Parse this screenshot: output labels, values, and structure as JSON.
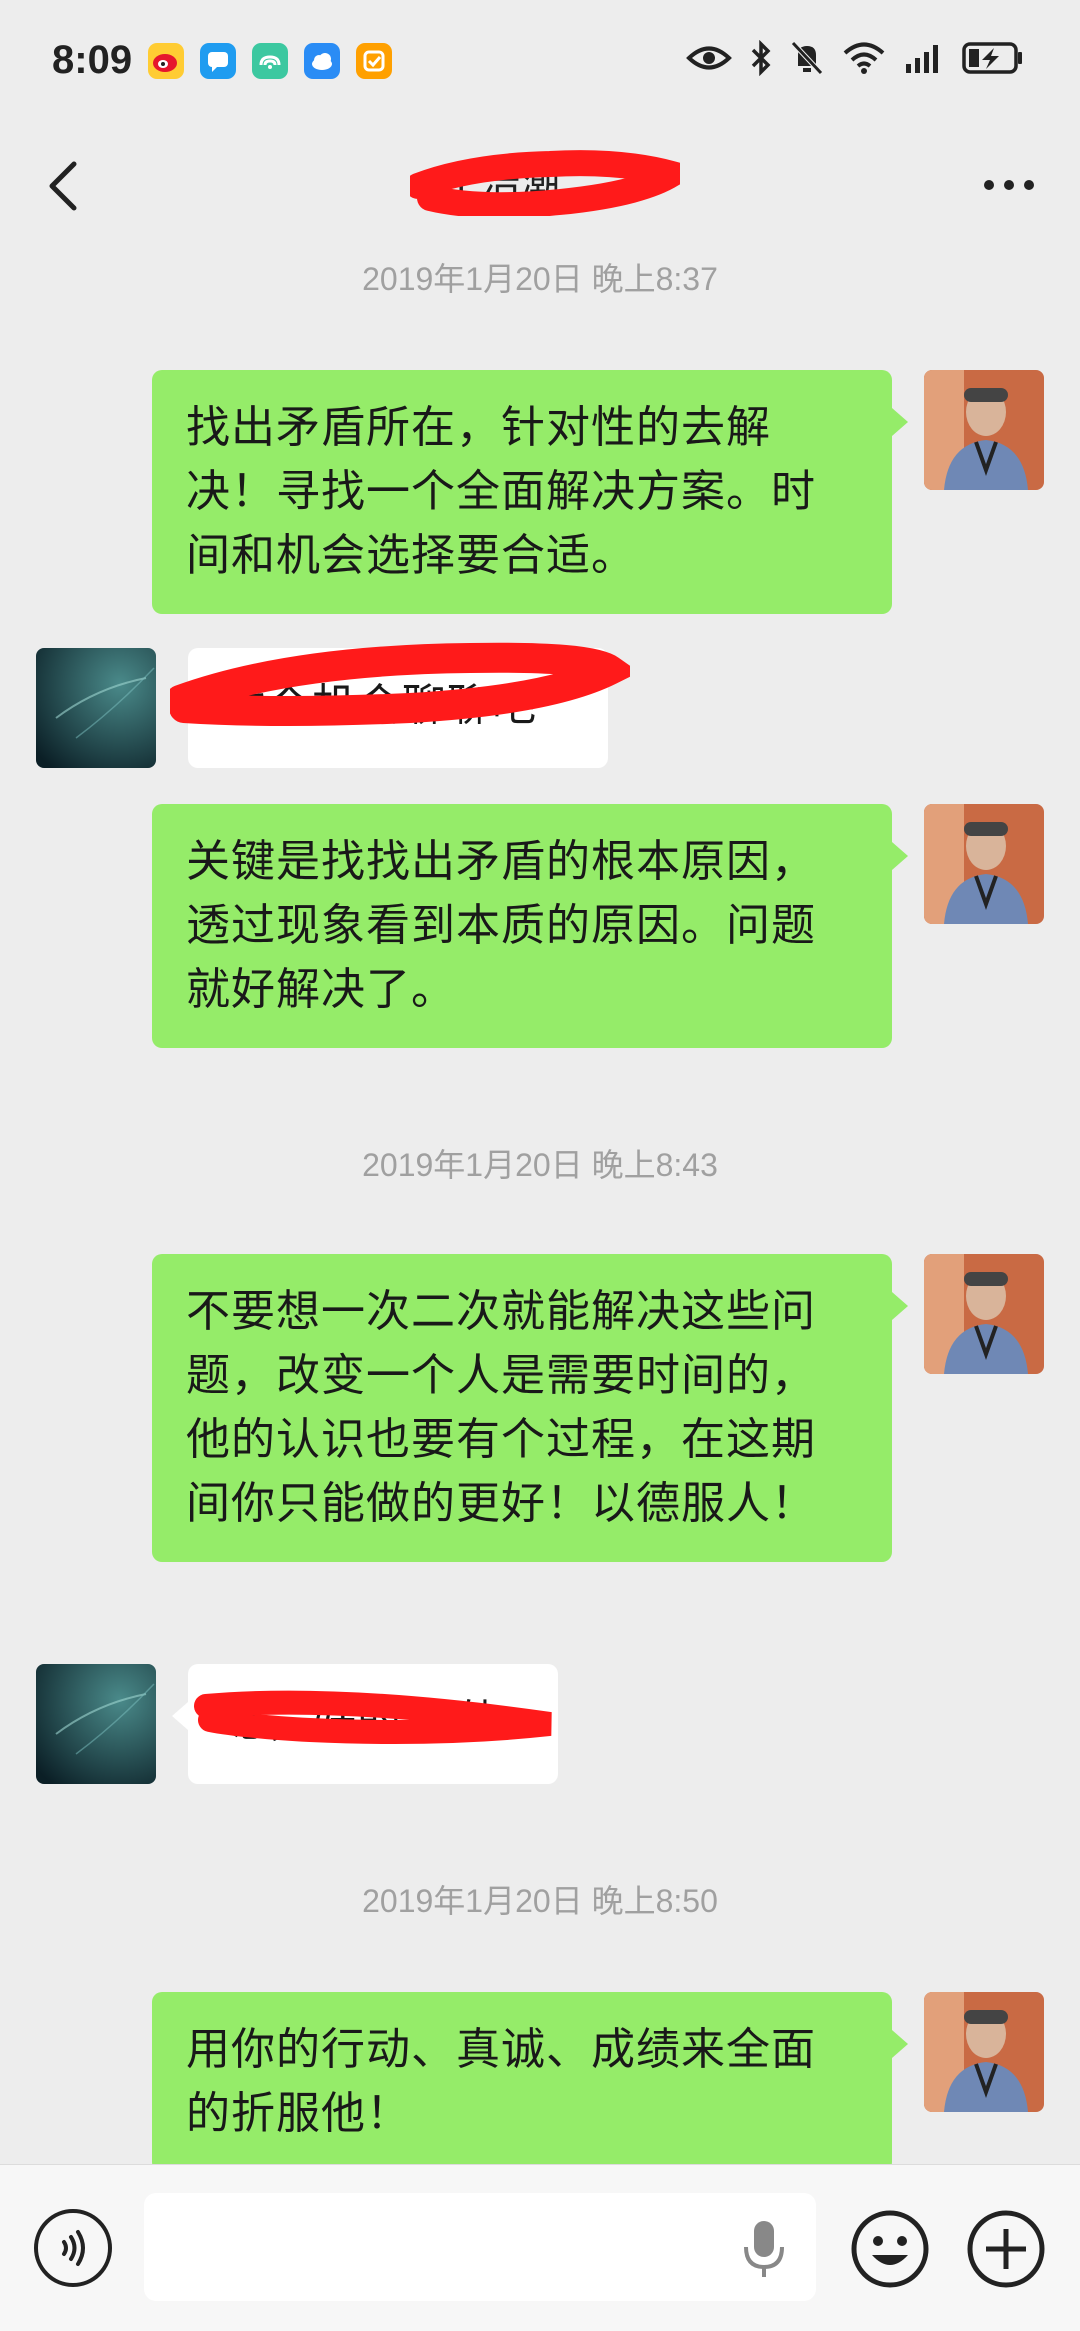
{
  "status_bar": {
    "time": "8:09",
    "app_icons": [
      "weibo-icon",
      "message-icon",
      "cloud-sync-icon",
      "cloud-icon",
      "mall-icon"
    ],
    "indicators": [
      "eye-icon",
      "bluetooth-icon",
      "mute-icon",
      "wifi-icon",
      "signal-icon",
      "battery-icon"
    ]
  },
  "header": {
    "title": "丁浩潮",
    "title_redacted": true,
    "back_icon": "chevron-left-icon",
    "more_icon": "more-icon"
  },
  "colors": {
    "background": "#ededed",
    "my_bubble": "#95ec69",
    "their_bubble": "#ffffff",
    "timestamp": "#a0a0a0",
    "redaction": "#ff1a1a"
  },
  "messages": [
    {
      "type": "timestamp",
      "text": "2019年1月20日 晚上8:37"
    },
    {
      "type": "bubble",
      "side": "right",
      "text": "找出矛盾所在，针对性的去解决！寻找一个全面解决方案。时间和机会选择要合适。"
    },
    {
      "type": "bubble",
      "side": "left",
      "text": "找个机会聊聊吧",
      "redacted": true
    },
    {
      "type": "bubble",
      "side": "right",
      "text": "关键是找找出矛盾的根本原因，透过现象看到本质的原因。问题就好解决了。"
    },
    {
      "type": "timestamp",
      "text": "2019年1月20日 晚上8:43"
    },
    {
      "type": "bubble",
      "side": "right",
      "text": "不要想一次二次就能解决这些问题，改变一个人是需要时间的，他的认识也要有个过程，在这期间你只能做的更好！以德服人！"
    },
    {
      "type": "bubble",
      "side": "left",
      "text": "嗯，好的谢谢",
      "redacted": true
    },
    {
      "type": "timestamp",
      "text": "2019年1月20日 晚上8:50"
    },
    {
      "type": "bubble",
      "side": "right",
      "text": "用你的行动、真诚、成绩来全面的折服他！"
    }
  ],
  "input_bar": {
    "placeholder": "",
    "voice_icon": "voice-icon",
    "mic_icon": "microphone-icon",
    "emoji_icon": "emoji-icon",
    "plus_icon": "plus-icon"
  }
}
